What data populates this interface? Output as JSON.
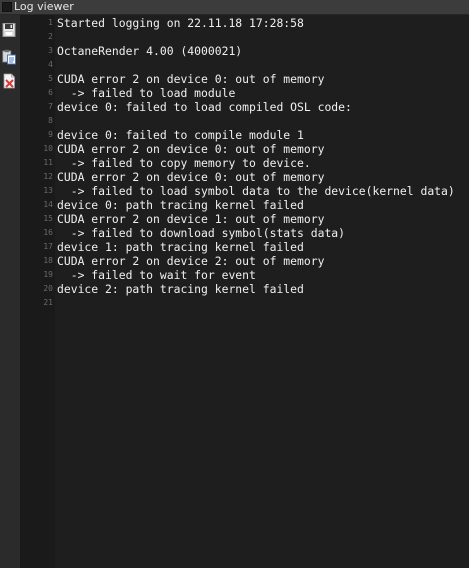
{
  "window": {
    "title": "Log viewer"
  },
  "toolbar": {
    "buttons": [
      {
        "icon": "save-icon",
        "label": "Save log"
      },
      {
        "icon": "copy-icon",
        "label": "Copy log"
      },
      {
        "icon": "clear-icon",
        "label": "Clear log"
      }
    ]
  },
  "colors": {
    "background": "#2b2b2b",
    "editor_background": "#1e1e1e",
    "gutter_background": "#1a1a1a",
    "text": "#f0f0f0",
    "line_number": "#6a6a6a",
    "clear_icon_accent": "#d93a3a"
  },
  "log": {
    "lines": [
      {
        "number": "1",
        "text": "Started logging on 22.11.18 17:28:58"
      },
      {
        "number": "2",
        "text": ""
      },
      {
        "number": "3",
        "text": "OctaneRender 4.00 (4000021)"
      },
      {
        "number": "4",
        "text": ""
      },
      {
        "number": "5",
        "text": "CUDA error 2 on device 0: out of memory"
      },
      {
        "number": "6",
        "text": "  -> failed to load module"
      },
      {
        "number": "7",
        "text": "device 0: failed to load compiled OSL code:"
      },
      {
        "number": "8",
        "text": ""
      },
      {
        "number": "9",
        "text": "device 0: failed to compile module 1"
      },
      {
        "number": "10",
        "text": "CUDA error 2 on device 0: out of memory"
      },
      {
        "number": "11",
        "text": "  -> failed to copy memory to device."
      },
      {
        "number": "12",
        "text": "CUDA error 2 on device 0: out of memory"
      },
      {
        "number": "13",
        "text": "  -> failed to load symbol data to the device(kernel data)"
      },
      {
        "number": "14",
        "text": "device 0: path tracing kernel failed"
      },
      {
        "number": "15",
        "text": "CUDA error 2 on device 1: out of memory"
      },
      {
        "number": "16",
        "text": "  -> failed to download symbol(stats data)"
      },
      {
        "number": "17",
        "text": "device 1: path tracing kernel failed"
      },
      {
        "number": "18",
        "text": "CUDA error 2 on device 2: out of memory"
      },
      {
        "number": "19",
        "text": "  -> failed to wait for event"
      },
      {
        "number": "20",
        "text": "device 2: path tracing kernel failed"
      },
      {
        "number": "21",
        "text": ""
      }
    ]
  }
}
